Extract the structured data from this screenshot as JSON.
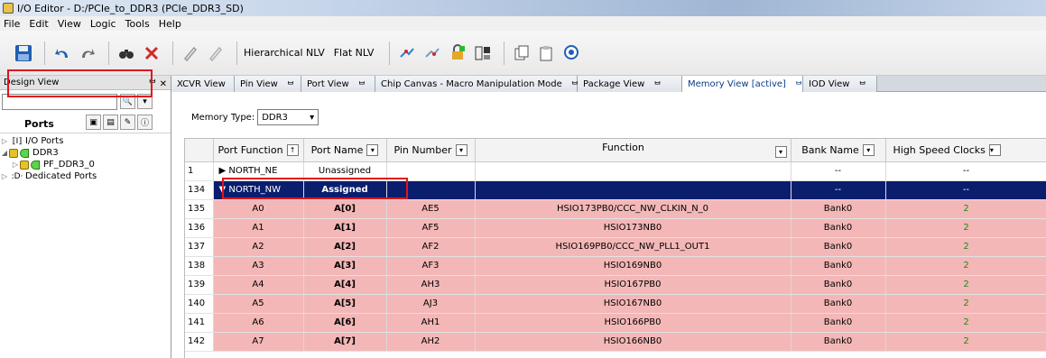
{
  "window": {
    "title": "I/O Editor - D:/PCIe_to_DDR3 (PCIe_DDR3_SD)"
  },
  "menu": [
    "File",
    "Edit",
    "View",
    "Logic",
    "Tools",
    "Help"
  ],
  "toolbar": {
    "hierarchical_nlv": "Hierarchical NLV",
    "flat_nlv": "Flat NLV"
  },
  "left": {
    "panel_title": "Design View",
    "close": "ᄇ ✕",
    "ports_label": "Ports",
    "tree": [
      {
        "label": "I/O Ports",
        "indent": 0
      },
      {
        "label": "DDR3",
        "indent": 0
      },
      {
        "label": "PF_DDR3_0",
        "indent": 1
      },
      {
        "label": "Dedicated Ports",
        "indent": 0
      }
    ]
  },
  "tabs": [
    "XCVR View",
    "Pin View",
    "Port View",
    "Chip Canvas - Macro Manipulation Mode",
    "Package View",
    "Memory View [active]",
    "IOD View"
  ],
  "memory": {
    "label": "Memory Type:",
    "value": "DDR3"
  },
  "table": {
    "headers": [
      "Port Function",
      "Port Name",
      "Pin Number",
      "Function",
      "Bank Name",
      "High Speed Clocks"
    ],
    "rows": [
      {
        "num": "1",
        "port_function": "NORTH_NE",
        "port_name": "Unassigned",
        "pin": "",
        "function": "",
        "bank": "--",
        "hsc": "--",
        "kind": "group-collapsed"
      },
      {
        "num": "134",
        "port_function": "NORTH_NW",
        "port_name": "Assigned",
        "pin": "",
        "function": "",
        "bank": "--",
        "hsc": "--",
        "kind": "selected"
      },
      {
        "num": "135",
        "port_function": "A0",
        "port_name": "A[0]",
        "pin": "AE5",
        "function": "HSIO173PB0/CCC_NW_CLKIN_N_0",
        "bank": "Bank0",
        "hsc": "2",
        "kind": "data"
      },
      {
        "num": "136",
        "port_function": "A1",
        "port_name": "A[1]",
        "pin": "AF5",
        "function": "HSIO173NB0",
        "bank": "Bank0",
        "hsc": "2",
        "kind": "data"
      },
      {
        "num": "137",
        "port_function": "A2",
        "port_name": "A[2]",
        "pin": "AF2",
        "function": "HSIO169PB0/CCC_NW_PLL1_OUT1",
        "bank": "Bank0",
        "hsc": "2",
        "kind": "data"
      },
      {
        "num": "138",
        "port_function": "A3",
        "port_name": "A[3]",
        "pin": "AF3",
        "function": "HSIO169NB0",
        "bank": "Bank0",
        "hsc": "2",
        "kind": "data"
      },
      {
        "num": "139",
        "port_function": "A4",
        "port_name": "A[4]",
        "pin": "AH3",
        "function": "HSIO167PB0",
        "bank": "Bank0",
        "hsc": "2",
        "kind": "data"
      },
      {
        "num": "140",
        "port_function": "A5",
        "port_name": "A[5]",
        "pin": "AJ3",
        "function": "HSIO167NB0",
        "bank": "Bank0",
        "hsc": "2",
        "kind": "data"
      },
      {
        "num": "141",
        "port_function": "A6",
        "port_name": "A[6]",
        "pin": "AH1",
        "function": "HSIO166PB0",
        "bank": "Bank0",
        "hsc": "2",
        "kind": "data"
      },
      {
        "num": "142",
        "port_function": "A7",
        "port_name": "A[7]",
        "pin": "AH2",
        "function": "HSIO166NB0",
        "bank": "Bank0",
        "hsc": "2",
        "kind": "data"
      }
    ]
  },
  "colors": {
    "highlight": "#e0141e",
    "selected_row": "#0b1e6e",
    "data_row": "#f4b7b7",
    "green_value": "#1d8a12"
  }
}
